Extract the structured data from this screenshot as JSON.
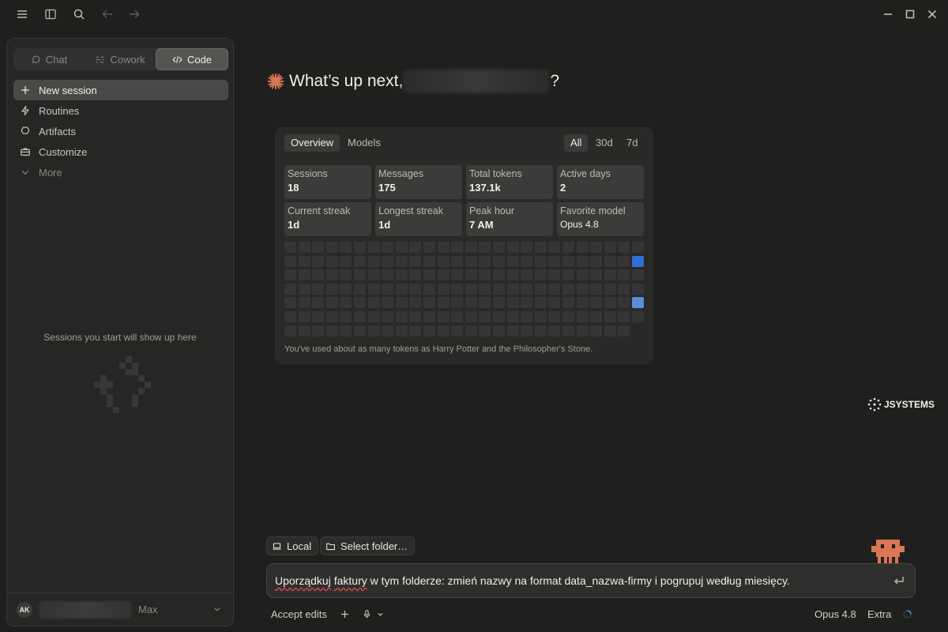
{
  "modes": [
    {
      "label": "Chat",
      "icon": "chat-icon",
      "active": false
    },
    {
      "label": "Cowork",
      "icon": "cowork-icon",
      "active": false
    },
    {
      "label": "Code",
      "icon": "code-icon",
      "active": true
    }
  ],
  "nav": [
    {
      "label": "New session",
      "icon": "plus-icon"
    },
    {
      "label": "Routines",
      "icon": "lightning-icon"
    },
    {
      "label": "Artifacts",
      "icon": "artifacts-icon"
    },
    {
      "label": "Customize",
      "icon": "briefcase-icon"
    },
    {
      "label": "More",
      "icon": "chevron-down-icon"
    }
  ],
  "sidebar": {
    "empty_text": "Sessions you start will show up here"
  },
  "user": {
    "initials": "AK",
    "plan": "Max"
  },
  "greeting": {
    "prefix": "What’s up next,",
    "suffix": "?"
  },
  "stats": {
    "tabs": [
      "Overview",
      "Models"
    ],
    "ranges": [
      "All",
      "30d",
      "7d"
    ],
    "cards": [
      {
        "label": "Sessions",
        "value": "18"
      },
      {
        "label": "Messages",
        "value": "175"
      },
      {
        "label": "Total tokens",
        "value": "137.1k"
      },
      {
        "label": "Active days",
        "value": "2"
      },
      {
        "label": "Current streak",
        "value": "1d"
      },
      {
        "label": "Longest streak",
        "value": "1d"
      },
      {
        "label": "Peak hour",
        "value": "7 AM"
      },
      {
        "label": "Favorite model",
        "value": "Opus 4.8"
      }
    ],
    "footer": "You've used about as many tokens as Harry Potter and the Philosopher's Stone."
  },
  "heatmap": {
    "weeks": 26,
    "days": 7,
    "active": [
      {
        "week": 25,
        "day": 1,
        "level": 2
      },
      {
        "week": 25,
        "day": 4,
        "level": 1
      }
    ],
    "colors": {
      "empty": "#353535",
      "level1": "#5b8fd9",
      "level2": "#2f6fd6"
    }
  },
  "logo": {
    "text": "JSYSTEMS"
  },
  "chips": {
    "local": "Local",
    "folder": "Select folder…"
  },
  "input": {
    "word1": "Uporządkuj",
    "word2": "faktury",
    "rest": " w tym folderze: zmień nazwy na format data_nazwa-firmy i pogrupuj według miesięcy."
  },
  "bottom": {
    "accept": "Accept edits",
    "model": "Opus 4.8",
    "effort": "Extra"
  },
  "colors": {
    "accent": "#d97757",
    "background": "#1f1f1e"
  }
}
